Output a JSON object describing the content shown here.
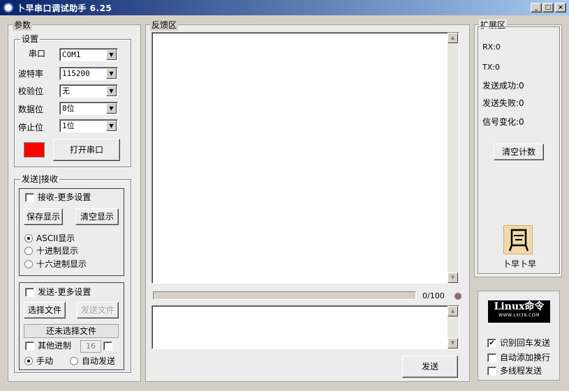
{
  "window": {
    "title": "卜早串口调试助手 6.25",
    "min": "_",
    "max": "□",
    "close": "×"
  },
  "params": {
    "legend": "参数",
    "settings": {
      "legend": "设置",
      "port_label": "串口",
      "port_value": "COM1",
      "baud_label": "波特率",
      "baud_value": "115200",
      "parity_label": "校验位",
      "parity_value": "无",
      "databits_label": "数据位",
      "databits_value": "8位",
      "stopbits_label": "停止位",
      "stopbits_value": "1位",
      "indicator_color": "#ff0000",
      "open_button": "打开串口"
    },
    "sendrecv": {
      "legend": "发送|接收",
      "recv_more": "接收-更多设置",
      "save_display": "保存显示",
      "clear_display": "清空显示",
      "ascii": "ASCII显示",
      "decimal": "十进制显示",
      "hex": "十六进制显示",
      "send_more": "发送-更多设置",
      "choose_file": "选择文件",
      "send_file": "发送文件",
      "no_file": "还未选择文件",
      "other_base": "其他进制",
      "base_value": "16",
      "manual": "手动",
      "auto_send": "自动发送"
    }
  },
  "feedback": {
    "legend": "反馈区",
    "progress_text": "0/100",
    "progress_value": 0,
    "send_button": "发送"
  },
  "ext": {
    "legend": "扩展区",
    "rx": "RX:0",
    "tx": "TX:0",
    "send_ok": "发送成功:0",
    "send_fail": "发送失败:0",
    "signal_change": "信号变化:0",
    "clear_count": "清空计数",
    "avatar_name": "卜早卜早"
  },
  "bottom_right": {
    "logo_text": "Linux命令",
    "logo_sub": "WWW.LXI38.COM",
    "opt_crlf": "识别回车发送",
    "opt_newline": "自动添加换行",
    "opt_multithread": "多线程发送"
  }
}
